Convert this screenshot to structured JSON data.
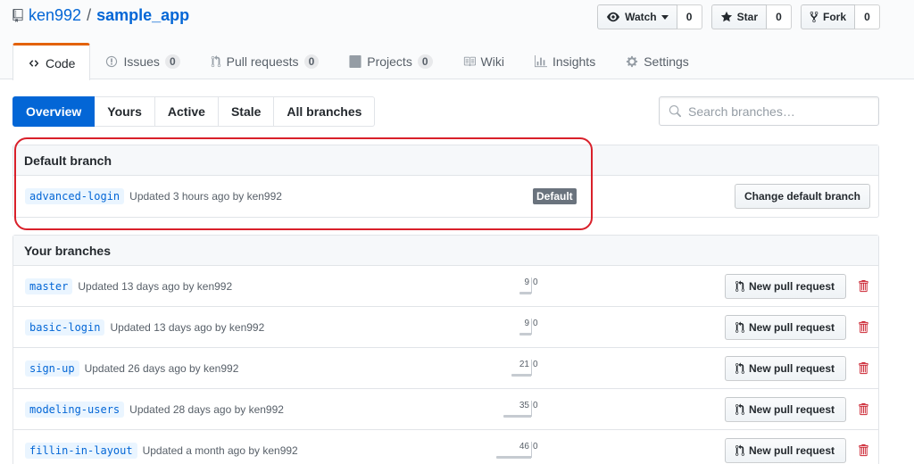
{
  "repo": {
    "owner": "ken992",
    "separator": "/",
    "name": "sample_app"
  },
  "actions": {
    "watch": {
      "label": "Watch",
      "count": "0"
    },
    "star": {
      "label": "Star",
      "count": "0"
    },
    "fork": {
      "label": "Fork",
      "count": "0"
    }
  },
  "tabs": [
    {
      "label": "Code",
      "icon": "code-icon"
    },
    {
      "label": "Issues",
      "counter": "0",
      "icon": "issue-icon"
    },
    {
      "label": "Pull requests",
      "counter": "0",
      "icon": "pull-request-icon"
    },
    {
      "label": "Projects",
      "counter": "0",
      "icon": "project-icon"
    },
    {
      "label": "Wiki",
      "icon": "book-icon"
    },
    {
      "label": "Insights",
      "icon": "graph-icon"
    },
    {
      "label": "Settings",
      "icon": "gear-icon"
    }
  ],
  "subnav": [
    "Overview",
    "Yours",
    "Active",
    "Stale",
    "All branches"
  ],
  "search": {
    "placeholder": "Search branches…"
  },
  "default_section": {
    "title": "Default branch",
    "branch": {
      "name": "advanced-login",
      "updated": "Updated 3 hours ago by ken992",
      "label": "Default"
    },
    "change_button": "Change default branch"
  },
  "your_branches": {
    "title": "Your branches",
    "new_pr_label": "New pull request",
    "branches": [
      {
        "name": "master",
        "updated": "Updated 13 days ago by ken992",
        "behind": "9",
        "ahead": "0",
        "behind_value": 9
      },
      {
        "name": "basic-login",
        "updated": "Updated 13 days ago by ken992",
        "behind": "9",
        "ahead": "0",
        "behind_value": 9
      },
      {
        "name": "sign-up",
        "updated": "Updated 26 days ago by ken992",
        "behind": "21",
        "ahead": "0",
        "behind_value": 21
      },
      {
        "name": "modeling-users",
        "updated": "Updated 28 days ago by ken992",
        "behind": "35",
        "ahead": "0",
        "behind_value": 35
      },
      {
        "name": "fillin-in-layout",
        "updated": "Updated a month ago by ken992",
        "behind": "46",
        "ahead": "0",
        "behind_value": 46
      }
    ]
  },
  "colors": {
    "accent": "#0366d6",
    "tab_highlight": "#e36209",
    "annotation": "#d9202a",
    "delete": "#cb2431"
  }
}
